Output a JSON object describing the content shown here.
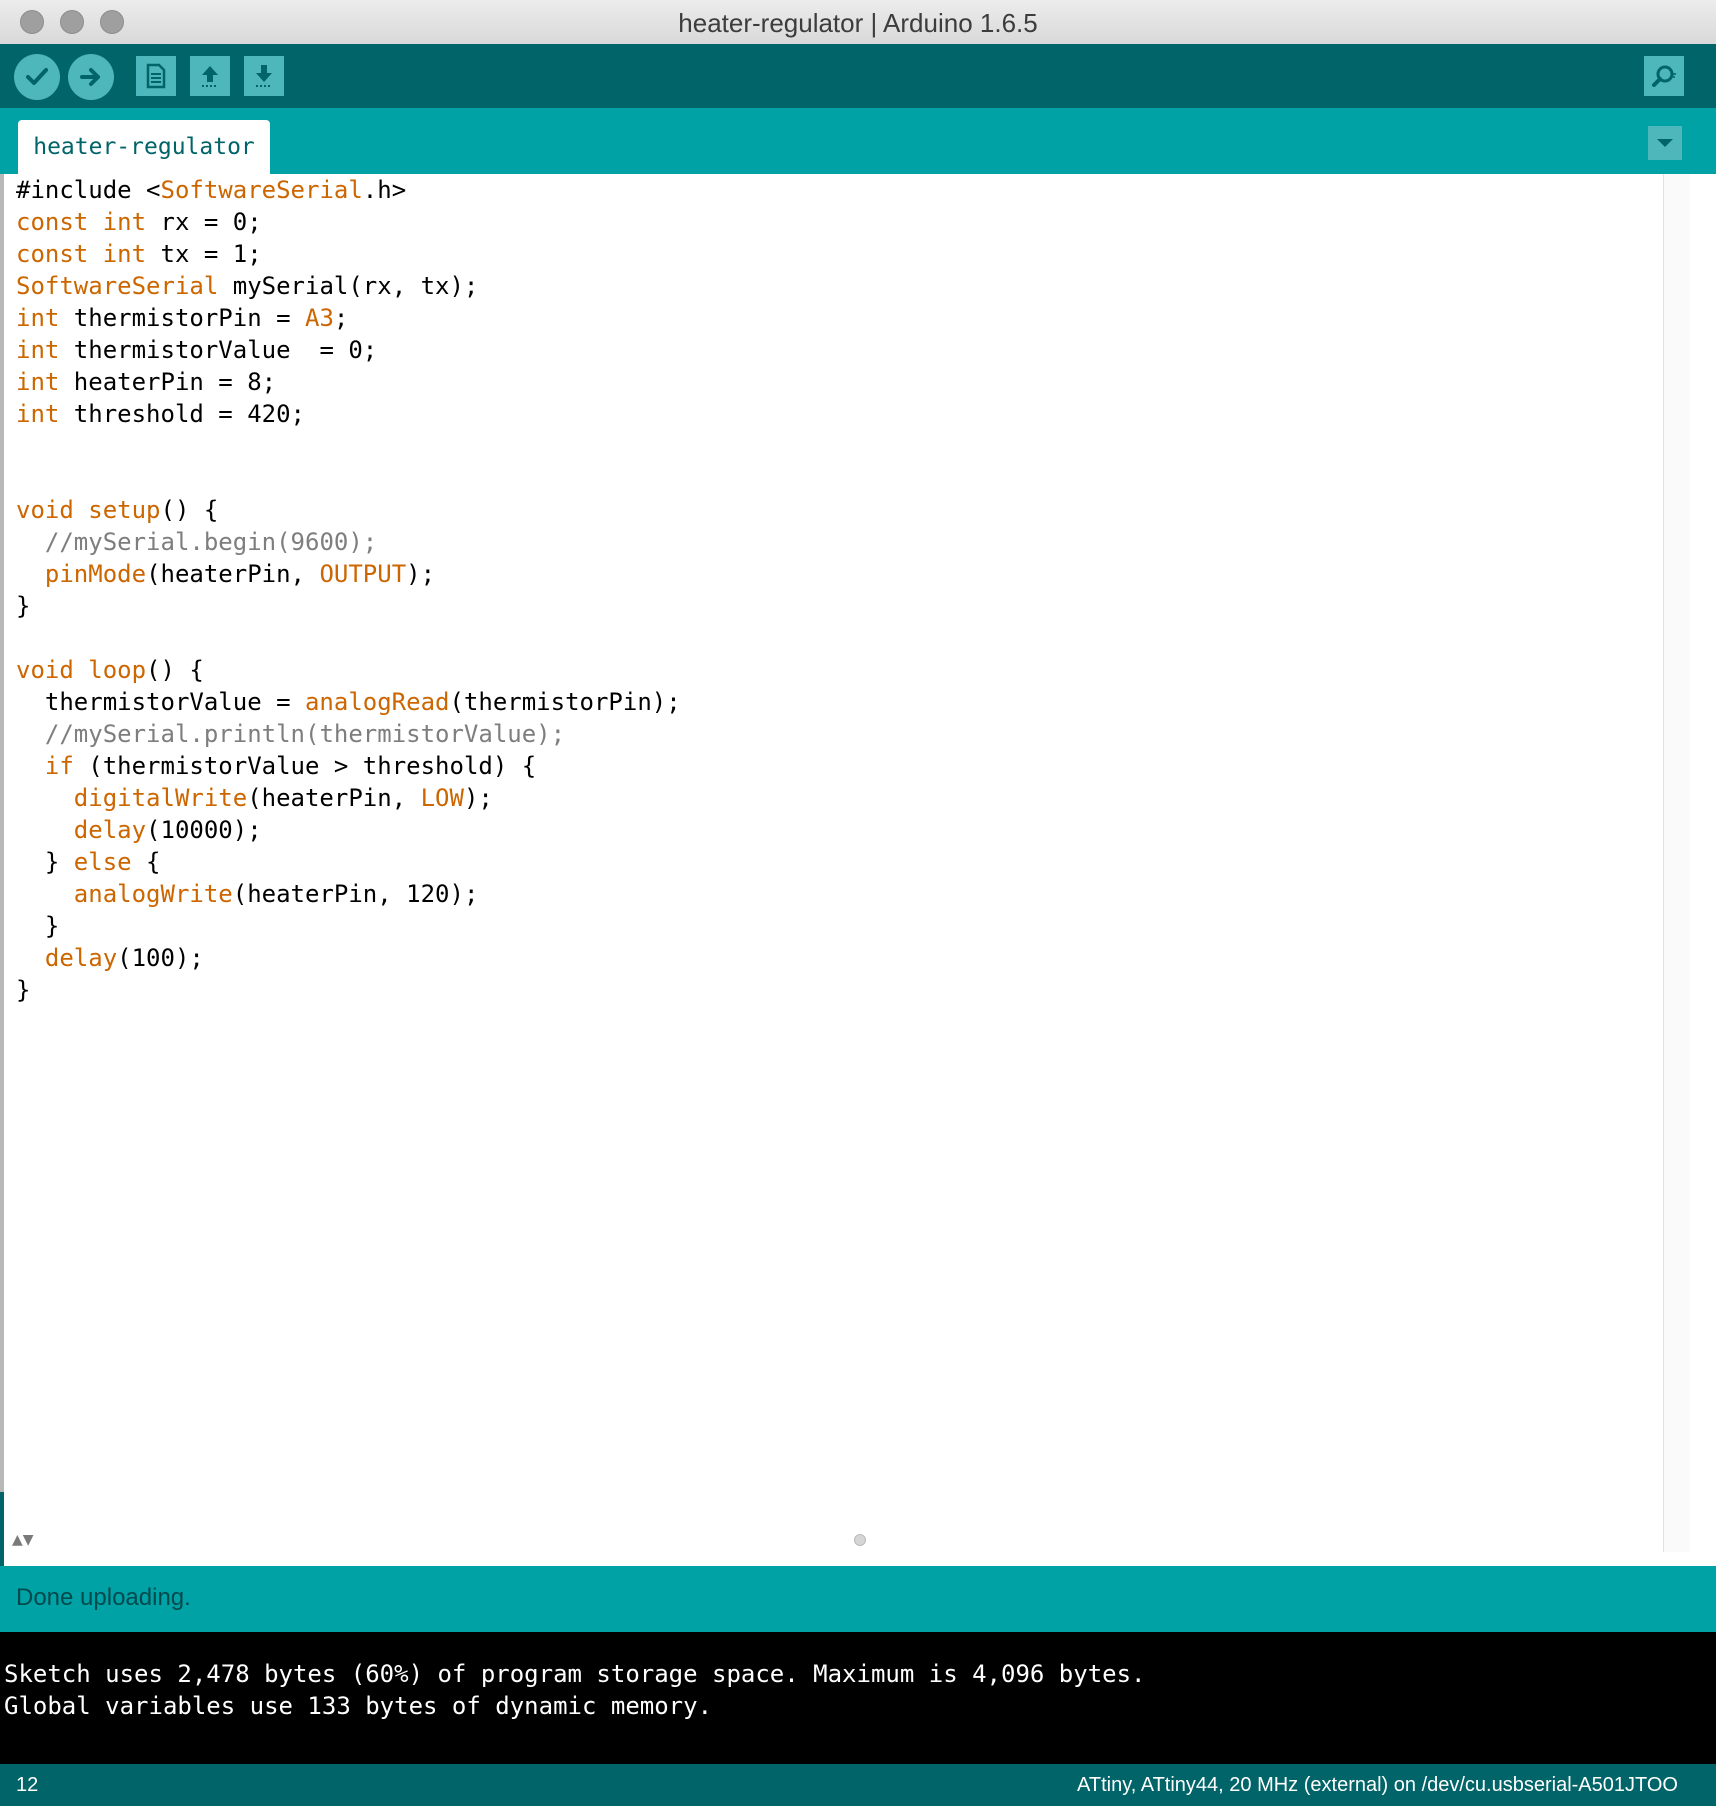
{
  "window": {
    "title": "heater-regulator | Arduino 1.6.5"
  },
  "toolbar": {
    "buttons": [
      {
        "name": "verify",
        "icon": "checkmark-icon"
      },
      {
        "name": "upload",
        "icon": "arrow-right-icon"
      },
      {
        "name": "new",
        "icon": "document-icon"
      },
      {
        "name": "open",
        "icon": "arrow-up-icon"
      },
      {
        "name": "save",
        "icon": "arrow-down-icon"
      },
      {
        "name": "serial-monitor",
        "icon": "magnifier-icon"
      }
    ]
  },
  "tabs": [
    {
      "label": "heater-regulator"
    }
  ],
  "editor": {
    "lines": [
      "#include <SoftwareSerial.h>",
      "const int rx = 0;",
      "const int tx = 1;",
      "SoftwareSerial mySerial(rx, tx);",
      "int thermistorPin = A3;",
      "int thermistorValue  = 0;",
      "int heaterPin = 8;",
      "int threshold = 420;",
      "",
      "",
      "void setup() {",
      "  //mySerial.begin(9600);",
      "  pinMode(heaterPin, OUTPUT);",
      "}",
      "",
      "void loop() {",
      "  thermistorValue = analogRead(thermistorPin);",
      "  //mySerial.println(thermistorValue);",
      "  if (thermistorValue > threshold) {",
      "    digitalWrite(heaterPin, LOW);",
      "    delay(10000);",
      "  } else {",
      "    analogWrite(heaterPin, 120);",
      "  }",
      "  delay(100);",
      "}"
    ]
  },
  "status": {
    "message": "Done uploading."
  },
  "console": {
    "lines": [
      "Sketch uses 2,478 bytes (60%) of program storage space. Maximum is 4,096 bytes.",
      "Global variables use 133 bytes of dynamic memory."
    ]
  },
  "footer": {
    "line_number": "12",
    "board": "ATtiny, ATtiny44, 20 MHz (external) on /dev/cu.usbserial-A501JTOO"
  },
  "colors": {
    "toolbar": "#006468",
    "tabbar": "#00a2a6",
    "button": "#4db7bb",
    "keyword": "#cc6600",
    "comment": "#7e7e7e"
  }
}
